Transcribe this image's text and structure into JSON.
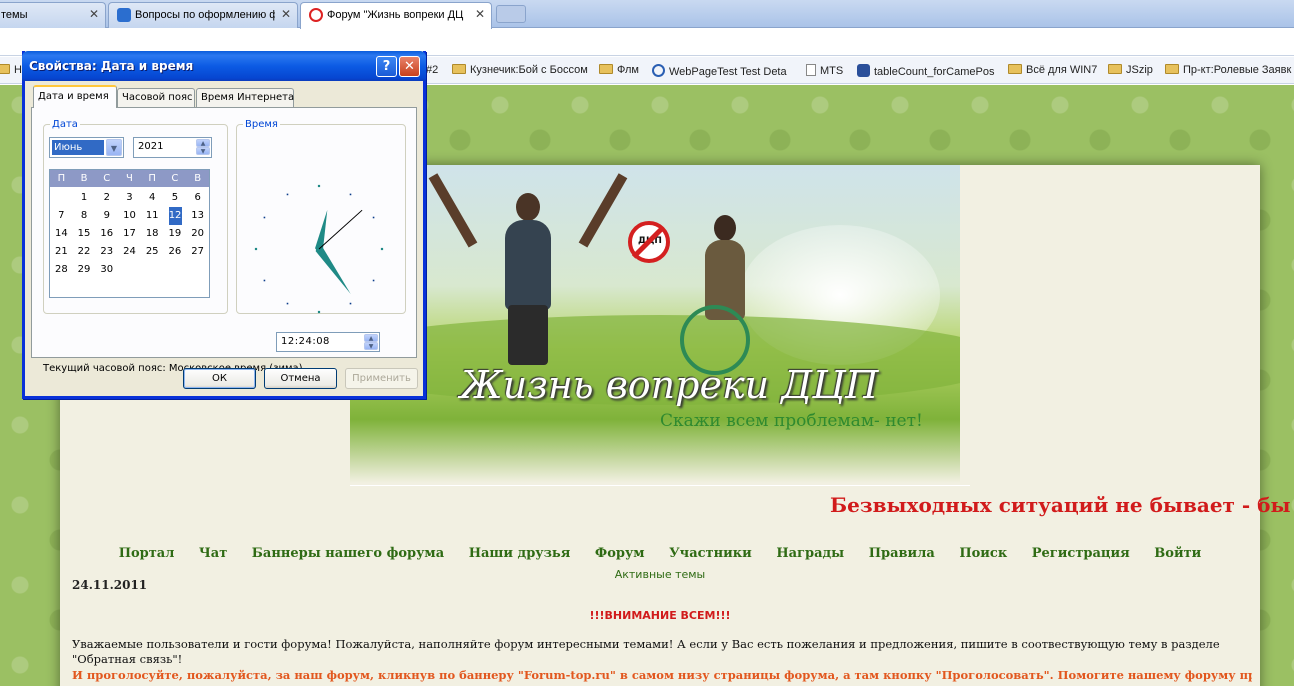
{
  "browser": {
    "tabs": [
      {
        "title": "темы",
        "close": "✕"
      },
      {
        "title": "Вопросы по оформлению ф",
        "close": "✕"
      },
      {
        "title": "Форум \"Жизнь вопреки ДЦ",
        "close": "✕"
      }
    ],
    "bookmarks": [
      {
        "label": "Н",
        "icon": "folder-icon"
      },
      {
        "label": "#2",
        "icon": "none"
      },
      {
        "label": "Кузнечик:Бой с Боссом",
        "icon": "folder-icon"
      },
      {
        "label": "Флм",
        "icon": "folder-icon"
      },
      {
        "label": "WebPageTest Test Deta",
        "icon": "webpagetest-icon"
      },
      {
        "label": "MTS",
        "icon": "page-icon"
      },
      {
        "label": "tableCount_forCamePos",
        "icon": "app-icon"
      },
      {
        "label": "Всё для WIN7",
        "icon": "folder-icon"
      },
      {
        "label": "JSzip",
        "icon": "folder-icon"
      },
      {
        "label": "Пр-кт:Ролевые Заявк",
        "icon": "folder-icon"
      }
    ]
  },
  "dialog": {
    "title": "Свойства: Дата и время",
    "help_btn": "?",
    "close_btn": "✕",
    "tabs": [
      "Дата и время",
      "Часовой пояс",
      "Время Интернета"
    ],
    "date_group": "Дата",
    "time_group": "Время",
    "month": "Июнь",
    "year": "2021",
    "weekdays": [
      "П",
      "В",
      "С",
      "Ч",
      "П",
      "С",
      "В"
    ],
    "calendar_rows": [
      [
        "",
        "1",
        "2",
        "3",
        "4",
        "5",
        "6"
      ],
      [
        "7",
        "8",
        "9",
        "10",
        "11",
        "12",
        "13"
      ],
      [
        "14",
        "15",
        "16",
        "17",
        "18",
        "19",
        "20"
      ],
      [
        "21",
        "22",
        "23",
        "24",
        "25",
        "26",
        "27"
      ],
      [
        "28",
        "29",
        "30",
        "",
        "",
        "",
        ""
      ]
    ],
    "selected_day": "12",
    "time": "12:24:08",
    "clock": {
      "hour": 12,
      "minute": 24,
      "second": 8
    },
    "timezone_text": "Текущий часовой пояс: Московское время (зима)",
    "ok": "ОК",
    "cancel": "Отмена",
    "apply": "Применить"
  },
  "page": {
    "banner_sign": "ДЦП",
    "banner_title": "Жизнь вопреки ДЦП",
    "banner_subtitle": "Скажи всем проблемам- нет!",
    "marquee": "Безвыходных ситуаций не бывает - бы",
    "nav": [
      "Портал",
      "Чат",
      "Баннеры нашего форума",
      "Наши друзья",
      "Форум",
      "Участники",
      "Награды",
      "Правила",
      "Поиск",
      "Регистрация",
      "Войти"
    ],
    "active_topics": "Активные темы",
    "date": "24.11.2011",
    "attention": "!!!ВНИМАНИЕ ВСЕМ!!!",
    "paragraph1": "Уважаемые пользователи и гости форума! Пожалуйста, наполняйте форум интересными темами! А если у Вас есть пожелания и предложения, пишите в соотвествующую тему в разделе \"Обратная связь\"!",
    "paragraph2": "И проголосуйте, пожалуйста, за наш форум, кликнув по баннеру \"Forum-top.ru\" в самом низу страницы форума, а там кнопку \"Проголосовать\". Помогите нашему форуму привлечь больше"
  },
  "colors": {
    "dialog_titlebar": "#0a5cdb",
    "page_background": "#9bc063",
    "nav_text": "#2f6b14",
    "marquee_text": "#d11b1b",
    "notice_text": "#e2571e",
    "calendar_selected": "#316ac5",
    "clock_hands": "#1f8a86"
  }
}
